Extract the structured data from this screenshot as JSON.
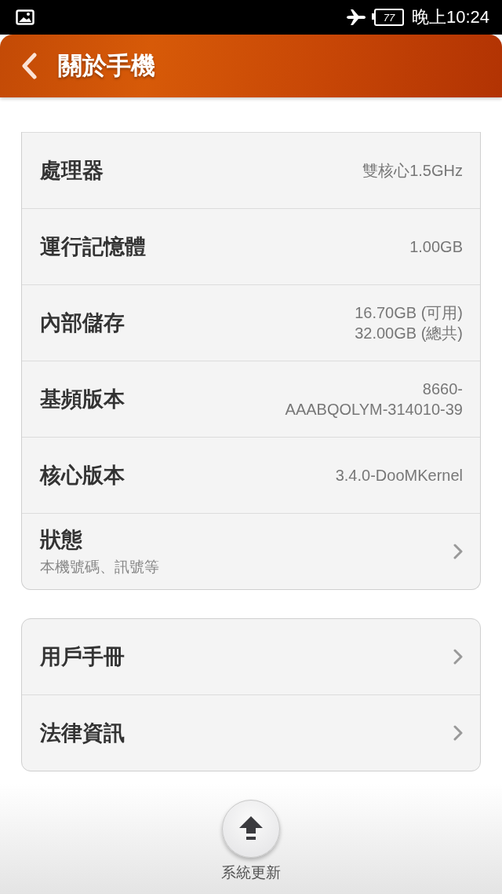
{
  "status_bar": {
    "time": "晚上10:24",
    "battery": "77"
  },
  "header": {
    "title": "關於手機"
  },
  "groups": [
    {
      "rows": [
        {
          "kind": "value",
          "label": "處理器",
          "value": "雙核心1.5GHz"
        },
        {
          "kind": "value",
          "label": "運行記憶體",
          "value": "1.00GB"
        },
        {
          "kind": "value",
          "label": "內部儲存",
          "value": "16.70GB (可用)\n32.00GB (總共)"
        },
        {
          "kind": "value",
          "label": "基頻版本",
          "value": "8660-\nAAABQOLYM-314010-39"
        },
        {
          "kind": "value",
          "label": "核心版本",
          "value": "3.4.0-DooMKernel"
        },
        {
          "kind": "nav",
          "label": "狀態",
          "subtitle": "本機號碼、訊號等"
        }
      ]
    },
    {
      "rows": [
        {
          "kind": "nav",
          "label": "用戶手冊"
        },
        {
          "kind": "nav",
          "label": "法律資訊"
        }
      ]
    }
  ],
  "update_button": {
    "label": "系統更新"
  }
}
